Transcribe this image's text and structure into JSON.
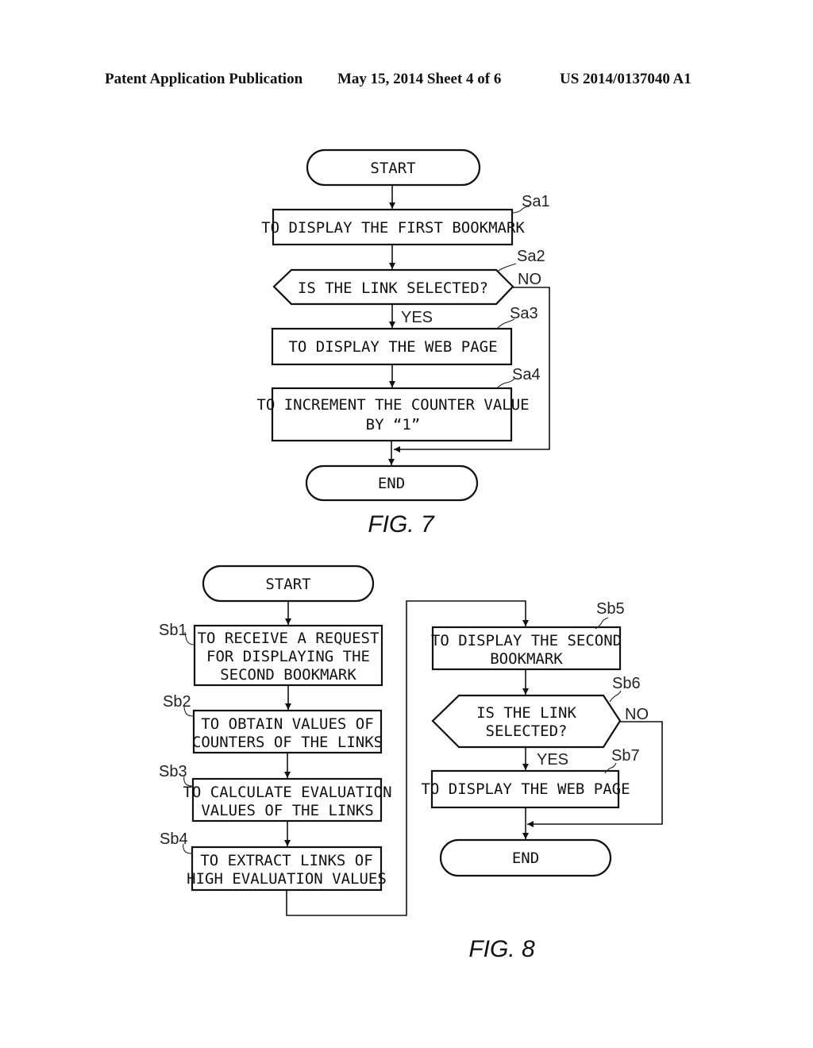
{
  "header": {
    "publication": "Patent Application Publication",
    "date_sheet": "May 15, 2014  Sheet 4 of 6",
    "number": "US 2014/0137040 A1"
  },
  "fig7": {
    "caption": "FIG. 7",
    "start": "START",
    "end": "END",
    "steps": [
      {
        "id": "Sa1",
        "lines": [
          "TO DISPLAY THE FIRST BOOKMARK"
        ]
      },
      {
        "id": "Sa2",
        "lines": [
          "IS THE LINK SELECTED?"
        ]
      },
      {
        "id": "Sa3",
        "lines": [
          "TO DISPLAY THE WEB PAGE"
        ]
      },
      {
        "id": "Sa4",
        "lines": [
          "TO INCREMENT THE COUNTER VALUE",
          "BY “1”"
        ]
      }
    ],
    "yes": "YES",
    "no": "NO"
  },
  "fig8": {
    "caption": "FIG. 8",
    "start": "START",
    "end": "END",
    "steps": [
      {
        "id": "Sb1",
        "lines": [
          "TO RECEIVE A REQUEST",
          "FOR DISPLAYING THE",
          "SECOND BOOKMARK"
        ]
      },
      {
        "id": "Sb2",
        "lines": [
          "TO OBTAIN VALUES OF",
          "COUNTERS OF THE LINKS"
        ]
      },
      {
        "id": "Sb3",
        "lines": [
          "TO CALCULATE EVALUATION",
          "VALUES OF THE LINKS"
        ]
      },
      {
        "id": "Sb4",
        "lines": [
          "TO EXTRACT LINKS OF",
          "HIGH EVALUATION VALUES"
        ]
      },
      {
        "id": "Sb5",
        "lines": [
          "TO DISPLAY THE SECOND",
          "BOOKMARK"
        ]
      },
      {
        "id": "Sb6",
        "lines": [
          "IS THE LINK",
          "SELECTED?"
        ]
      },
      {
        "id": "Sb7",
        "lines": [
          "TO DISPLAY THE WEB PAGE"
        ]
      }
    ],
    "yes": "YES",
    "no": "NO"
  }
}
